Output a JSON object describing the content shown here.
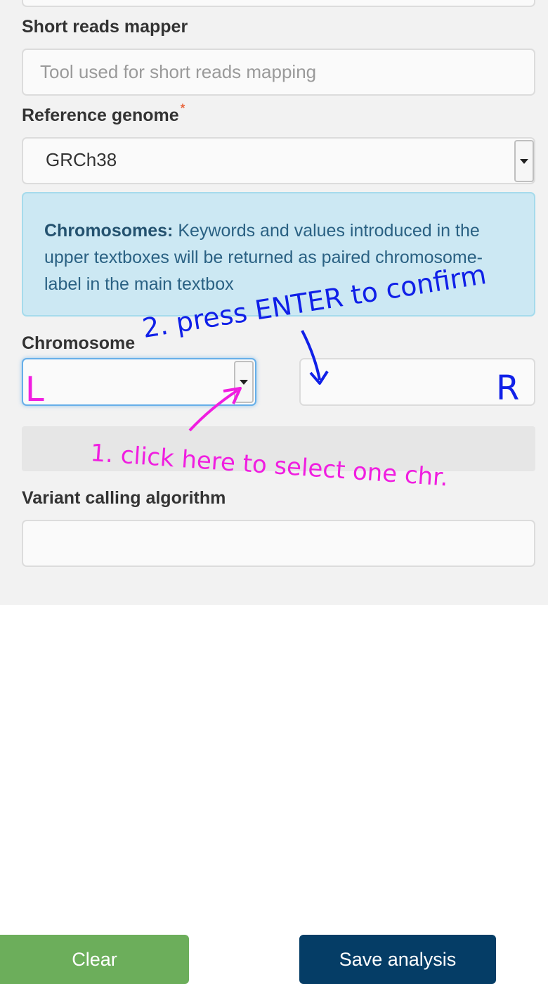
{
  "form": {
    "short_reads_mapper": {
      "label": "Short reads mapper",
      "placeholder": "Tool used for short reads mapping",
      "value": ""
    },
    "reference_genome": {
      "label": "Reference genome",
      "required_marker": "*",
      "value": "GRCh38"
    },
    "info": {
      "title": "Chromosomes:",
      "text": "Keywords and values introduced in the upper textboxes will be returned as paired chromosome-label in the main textbox"
    },
    "chromosome": {
      "label": "Chromosome",
      "left_value": "",
      "right_value": ""
    },
    "variant_calling": {
      "label": "Variant calling algorithm",
      "value": ""
    }
  },
  "buttons": {
    "clear": "Clear",
    "save": "Save analysis"
  },
  "annotations": {
    "step1": "1. click here to select one chr.",
    "step2": "2. press ENTER to confirm",
    "left_letter": "L",
    "right_letter": "R",
    "colors": {
      "step1": "#f01ee0",
      "step2": "#1020e8"
    }
  }
}
